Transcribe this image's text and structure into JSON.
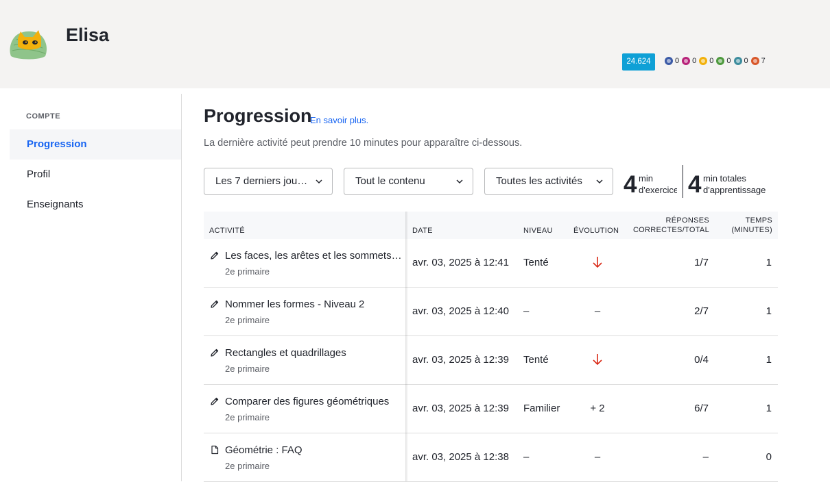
{
  "user": {
    "name": "Elisa",
    "points": "24.624"
  },
  "badges": [
    {
      "icon": "badge-blue-icon",
      "color": "#3b5aa6",
      "count": "0"
    },
    {
      "icon": "badge-magenta-icon",
      "color": "#b8237a",
      "count": "0"
    },
    {
      "icon": "badge-gold-icon",
      "color": "#f2b10c",
      "count": "0"
    },
    {
      "icon": "badge-green-icon",
      "color": "#4e9a3e",
      "count": "0"
    },
    {
      "icon": "badge-teal-icon",
      "color": "#3d8d9e",
      "count": "0"
    },
    {
      "icon": "badge-orange-icon",
      "color": "#d8572a",
      "count": "7"
    }
  ],
  "sidebar": {
    "heading": "COMPTE",
    "items": [
      {
        "label": "Progression",
        "active": true
      },
      {
        "label": "Profil",
        "active": false
      },
      {
        "label": "Enseignants",
        "active": false
      }
    ]
  },
  "main": {
    "title": "Progression",
    "learn_more": "En savoir plus.",
    "subtitle": "La dernière activité peut prendre 10 minutes pour apparaître ci-dessous."
  },
  "filters": {
    "period": "Les 7 derniers jou…",
    "content": "Tout le contenu",
    "activities": "Toutes les activités"
  },
  "stats": {
    "exercise_minutes": "4",
    "exercise_unit_line1": "min",
    "exercise_unit_line2": "d'exercice",
    "total_minutes": "4",
    "total_unit_line1": "min totales",
    "total_unit_line2": "d'apprentissage"
  },
  "table": {
    "headers": {
      "activity": "ACTIVITÉ",
      "date": "DATE",
      "level": "NIVEAU",
      "evolution": "ÉVOLUTION",
      "score_line1": "RÉPONSES",
      "score_line2": "CORRECTES/TOTAL",
      "time_line1": "TEMPS",
      "time_line2": "(MINUTES)"
    },
    "rows": [
      {
        "icon": "pencil-icon",
        "title": "Les faces, les arêtes et les sommets…",
        "grade": "2e primaire",
        "date": "avr. 03, 2025 à 12:41",
        "level": "Tenté",
        "evolution": "",
        "evolution_down": true,
        "score": "1/7",
        "time": "1"
      },
      {
        "icon": "pencil-icon",
        "title": "Nommer les formes - Niveau 2",
        "grade": "2e primaire",
        "date": "avr. 03, 2025 à 12:40",
        "level": "–",
        "evolution": "–",
        "evolution_down": false,
        "score": "2/7",
        "time": "1"
      },
      {
        "icon": "pencil-icon",
        "title": "Rectangles et quadrillages",
        "grade": "2e primaire",
        "date": "avr. 03, 2025 à 12:39",
        "level": "Tenté",
        "evolution": "",
        "evolution_down": true,
        "score": "0/4",
        "time": "1"
      },
      {
        "icon": "pencil-icon",
        "title": "Comparer des figures géométriques",
        "grade": "2e primaire",
        "date": "avr. 03, 2025 à 12:39",
        "level": "Familier",
        "evolution": "+ 2",
        "evolution_down": false,
        "score": "6/7",
        "time": "1"
      },
      {
        "icon": "document-icon",
        "title": "Géométrie : FAQ",
        "grade": "2e primaire",
        "date": "avr. 03, 2025 à 12:38",
        "level": "–",
        "evolution": "–",
        "evolution_down": false,
        "score": "–",
        "time": "0"
      }
    ]
  }
}
